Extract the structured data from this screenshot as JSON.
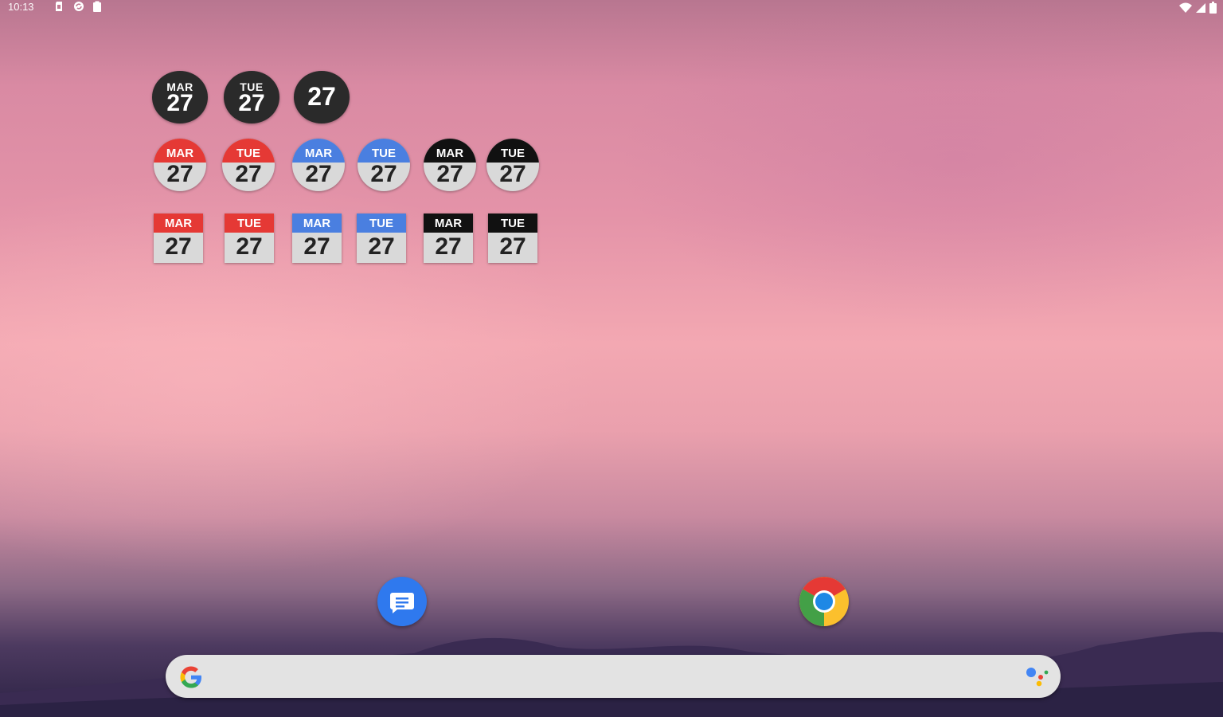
{
  "status_bar": {
    "time": "10:13",
    "left_icons": [
      "sd-card-icon",
      "sync-icon",
      "clipboard-icon"
    ],
    "right_icons": [
      "wifi-icon",
      "signal-icon",
      "battery-icon"
    ]
  },
  "widgets": {
    "row1": [
      {
        "top": "MAR",
        "day": "27",
        "style": "dark-circle"
      },
      {
        "top": "TUE",
        "day": "27",
        "style": "dark-circle"
      },
      {
        "top": "",
        "day": "27",
        "style": "dark-circle"
      }
    ],
    "row2": [
      {
        "top": "MAR",
        "day": "27",
        "style": "red"
      },
      {
        "top": "TUE",
        "day": "27",
        "style": "red"
      },
      {
        "top": "MAR",
        "day": "27",
        "style": "blue"
      },
      {
        "top": "TUE",
        "day": "27",
        "style": "blue"
      },
      {
        "top": "MAR",
        "day": "27",
        "style": "black"
      },
      {
        "top": "TUE",
        "day": "27",
        "style": "black"
      }
    ],
    "row3": [
      {
        "top": "MAR",
        "day": "27",
        "style": "red"
      },
      {
        "top": "TUE",
        "day": "27",
        "style": "red"
      },
      {
        "top": "MAR",
        "day": "27",
        "style": "blue"
      },
      {
        "top": "TUE",
        "day": "27",
        "style": "blue"
      },
      {
        "top": "MAR",
        "day": "27",
        "style": "black"
      },
      {
        "top": "TUE",
        "day": "27",
        "style": "black"
      }
    ]
  },
  "colors": {
    "red": "#e53935",
    "blue": "#4a7fe0",
    "black": "#111111",
    "dark": "#2a2a2a"
  },
  "dock": {
    "apps": [
      "messages",
      "chrome"
    ]
  },
  "search": {
    "placeholder": ""
  }
}
